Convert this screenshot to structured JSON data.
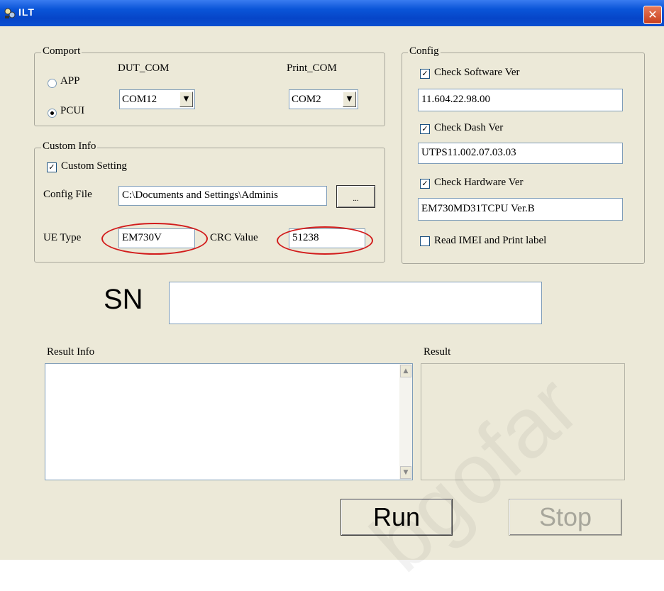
{
  "window": {
    "title": "ILT",
    "close_symbol": "✕"
  },
  "comport": {
    "legend": "Comport",
    "radio_app": "APP",
    "radio_pcui": "PCUI",
    "dut_label": "DUT_COM",
    "dut_value": "COM12",
    "print_label": "Print_COM",
    "print_value": "COM2"
  },
  "custom_info": {
    "legend": "Custom Info",
    "custom_setting": "Custom Setting",
    "config_file_label": "Config File",
    "config_file_value": "C:\\Documents and Settings\\Adminis",
    "browse_label": "...",
    "ue_type_label": "UE Type",
    "ue_type_value": "EM730V",
    "crc_label": "CRC Value",
    "crc_value": "51238"
  },
  "config": {
    "legend": "Config",
    "check_software": "Check Software Ver",
    "software_value": "11.604.22.98.00",
    "check_dash": "Check Dash Ver",
    "dash_value": "UTPS11.002.07.03.03",
    "check_hardware": "Check  Hardware Ver",
    "hardware_value": "EM730MD31TCPU Ver.B",
    "read_imei": "Read  IMEI and Print label"
  },
  "sn": {
    "label": "SN",
    "value": ""
  },
  "result_info": {
    "label": "Result Info"
  },
  "result": {
    "label": "Result"
  },
  "buttons": {
    "run": "Run",
    "stop": "Stop"
  },
  "watermark": "bgofar",
  "colors": {
    "titlebar": "#0a55d8",
    "highlight": "#d21c1c",
    "face": "#ece9d8"
  }
}
